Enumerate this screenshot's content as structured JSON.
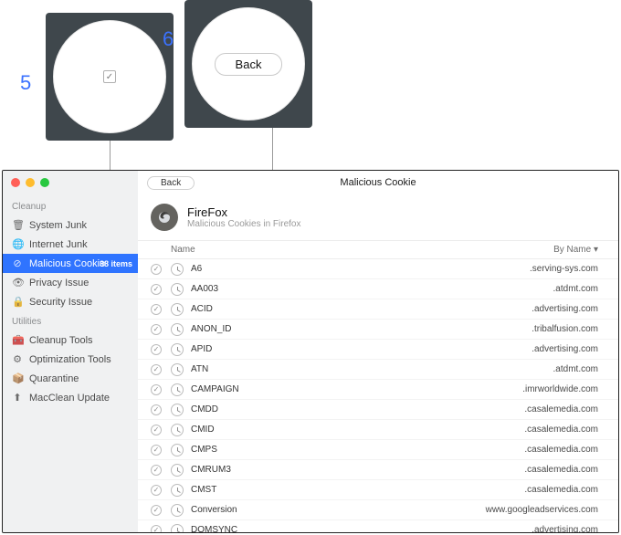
{
  "annotations": {
    "callout5": {
      "num": "5",
      "checkbox_checked": true
    },
    "callout6": {
      "num": "6",
      "label": "Back"
    }
  },
  "sidebar": {
    "sections": [
      {
        "label": "Cleanup",
        "items": [
          {
            "icon": "trash-icon",
            "glyph": "🗑",
            "label": "System Junk",
            "active": false
          },
          {
            "icon": "globe-icon",
            "glyph": "🌐",
            "label": "Internet Junk",
            "active": false
          },
          {
            "icon": "cookie-icon",
            "glyph": "⊘",
            "label": "Malicious Cookie",
            "active": true,
            "badge": "38 items"
          },
          {
            "icon": "eye-icon",
            "glyph": "👁",
            "label": "Privacy Issue",
            "active": false
          },
          {
            "icon": "lock-icon",
            "glyph": "🔒",
            "label": "Security Issue",
            "active": false
          }
        ]
      },
      {
        "label": "Utilities",
        "items": [
          {
            "icon": "toolbox-icon",
            "glyph": "🧰",
            "label": "Cleanup Tools"
          },
          {
            "icon": "gear-icon",
            "glyph": "⚙",
            "label": "Optimization Tools"
          },
          {
            "icon": "package-icon",
            "glyph": "📦",
            "label": "Quarantine"
          },
          {
            "icon": "update-icon",
            "glyph": "⬆",
            "label": "MacClean Update"
          }
        ]
      }
    ]
  },
  "toolbar": {
    "back_label": "Back",
    "title": "Malicious Cookie"
  },
  "list": {
    "app": {
      "name": "FireFox",
      "subtitle": "Malicious Cookies in Firefox"
    },
    "columns": {
      "check": "",
      "name": "Name",
      "by": "By Name"
    },
    "rows": [
      {
        "name": "A6",
        "by": ".serving-sys.com"
      },
      {
        "name": "AA003",
        "by": ".atdmt.com"
      },
      {
        "name": "ACID",
        "by": ".advertising.com"
      },
      {
        "name": "ANON_ID",
        "by": ".tribalfusion.com"
      },
      {
        "name": "APID",
        "by": ".advertising.com"
      },
      {
        "name": "ATN",
        "by": ".atdmt.com"
      },
      {
        "name": "CAMPAIGN",
        "by": ".imrworldwide.com"
      },
      {
        "name": "CMDD",
        "by": ".casalemedia.com"
      },
      {
        "name": "CMID",
        "by": ".casalemedia.com"
      },
      {
        "name": "CMPS",
        "by": ".casalemedia.com"
      },
      {
        "name": "CMRUM3",
        "by": ".casalemedia.com"
      },
      {
        "name": "CMST",
        "by": ".casalemedia.com"
      },
      {
        "name": "Conversion",
        "by": "www.googleadservices.com"
      },
      {
        "name": "DOMSYNC",
        "by": ".advertising.com"
      }
    ]
  }
}
